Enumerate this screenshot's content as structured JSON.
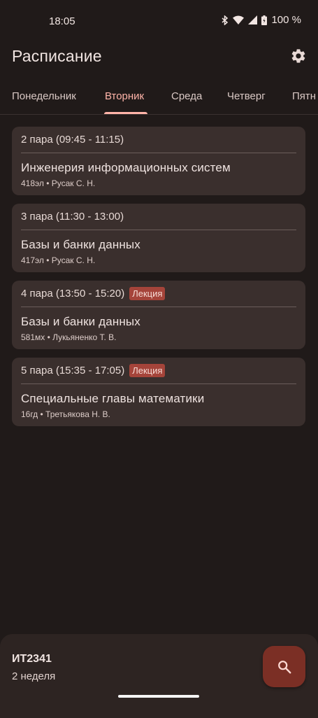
{
  "status_bar": {
    "time": "18:05",
    "battery": "100 %",
    "icons": [
      "bluetooth-icon",
      "wifi-icon",
      "signal-icon",
      "battery-icon"
    ]
  },
  "app_bar": {
    "title": "Расписание",
    "settings_icon": "gear-icon"
  },
  "tabs": [
    {
      "label": "Понедельник",
      "active": false
    },
    {
      "label": "Вторник",
      "active": true
    },
    {
      "label": "Среда",
      "active": false
    },
    {
      "label": "Четверг",
      "active": false
    },
    {
      "label": "Пятн",
      "active": false
    }
  ],
  "lessons": [
    {
      "time": "2 пара (09:45 - 11:15)",
      "badge": "",
      "subject": "Инженерия информационных систем",
      "details": "418эл • Русак С. Н."
    },
    {
      "time": "3 пара (11:30 - 13:00)",
      "badge": "",
      "subject": "Базы и банки данных",
      "details": "417эл • Русак С. Н."
    },
    {
      "time": "4 пара (13:50 - 15:20)",
      "badge": "Лекция",
      "subject": "Базы и банки данных",
      "details": "581мх • Лукьяненко Т. В."
    },
    {
      "time": "5 пара (15:35 - 17:05)",
      "badge": "Лекция",
      "subject": "Специальные главы математики",
      "details": "16гд • Третьякова Н. В."
    }
  ],
  "bottom": {
    "group": "ИТ2341",
    "week": "2 неделя",
    "fab_icon": "search-icon"
  },
  "colors": {
    "background": "#201a19",
    "card": "#3a2f2d",
    "accent": "#ffb4a9",
    "badge": "#a5443a",
    "fab": "#7b2f25"
  }
}
